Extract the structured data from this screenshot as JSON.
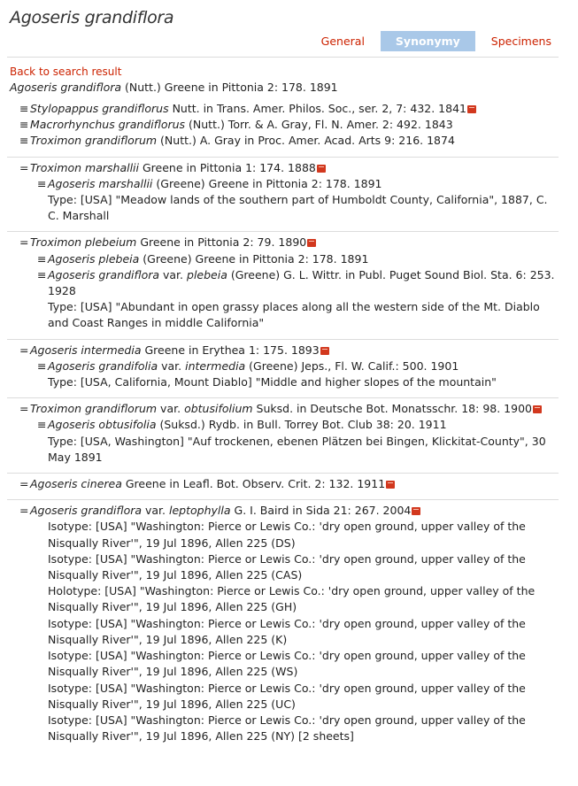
{
  "title": "Agoseris grandiflora",
  "tabs": [
    {
      "label": "General",
      "active": false
    },
    {
      "label": "Synonymy",
      "active": true
    },
    {
      "label": "Specimens",
      "active": false
    }
  ],
  "back_link": "Back to search result",
  "accepted": {
    "name": "Agoseris grandiflora",
    "rest": " (Nutt.) Greene in Pittonia 2: 178. 1891"
  },
  "groups": [
    {
      "lines": [
        {
          "level": 0,
          "sym": "≡",
          "name": "Stylopappus grandiflorus",
          "rest": " Nutt. in Trans. Amer. Philos. Soc., ser. 2, 7: 432. 1841",
          "book": true
        },
        {
          "level": 0,
          "sym": "≡",
          "name": "Macrorhynchus grandiflorus",
          "rest": " (Nutt.) Torr. & A. Gray, Fl. N. Amer. 2: 492. 1843"
        },
        {
          "level": 0,
          "sym": "≡",
          "name": "Troximon grandiflorum",
          "rest": " (Nutt.) A. Gray in Proc. Amer. Acad. Arts 9: 216. 1874"
        }
      ]
    },
    {
      "lines": [
        {
          "level": 0,
          "sym": "=",
          "name": "Troximon marshallii",
          "rest": " Greene in Pittonia 1: 174. 1888",
          "book": true
        },
        {
          "level": 1,
          "sym": "≡",
          "name": "Agoseris marshallii",
          "rest": " (Greene) Greene in Pittonia 2: 178. 1891"
        },
        {
          "level": "t",
          "text": "Type: [USA] \"Meadow lands of the southern part of Humboldt County, California\", 1887, C. C. Marshall"
        }
      ]
    },
    {
      "lines": [
        {
          "level": 0,
          "sym": "=",
          "name": "Troximon plebeium",
          "rest": " Greene in Pittonia 2: 79. 1890",
          "book": true
        },
        {
          "level": 1,
          "sym": "≡",
          "name": "Agoseris plebeia",
          "rest": " (Greene) Greene in Pittonia 2: 178. 1891"
        },
        {
          "level": 1,
          "sym": "≡",
          "name": "Agoseris grandiflora",
          "mid": " var. ",
          "name2": "plebeia",
          "rest": " (Greene) G. L. Wittr. in Publ. Puget Sound Biol. Sta. 6: 253. 1928"
        },
        {
          "level": "t",
          "text": "Type: [USA] \"Abundant in open grassy places along all the western side of the Mt. Diablo and Coast Ranges in middle California\""
        }
      ]
    },
    {
      "lines": [
        {
          "level": 0,
          "sym": "=",
          "name": "Agoseris intermedia",
          "rest": " Greene in Erythea 1: 175. 1893",
          "book": true
        },
        {
          "level": 1,
          "sym": "≡",
          "name": "Agoseris grandifolia",
          "mid": " var. ",
          "name2": "intermedia",
          "rest": " (Greene) Jeps., Fl. W. Calif.: 500. 1901"
        },
        {
          "level": "t",
          "text": "Type: [USA, California, Mount Diablo] \"Middle and higher slopes of the mountain\""
        }
      ]
    },
    {
      "lines": [
        {
          "level": 0,
          "sym": "=",
          "name": "Troximon grandiflorum",
          "mid": " var. ",
          "name2": "obtusifolium",
          "rest": " Suksd. in Deutsche Bot. Monatsschr. 18: 98. 1900",
          "book": true
        },
        {
          "level": 1,
          "sym": "≡",
          "name": "Agoseris obtusifolia",
          "rest": " (Suksd.) Rydb. in Bull. Torrey Bot. Club 38: 20. 1911"
        },
        {
          "level": "t",
          "text": "Type: [USA, Washington] \"Auf trockenen, ebenen Plätzen bei Bingen, Klickitat-County\", 30 May 1891"
        }
      ]
    },
    {
      "lines": [
        {
          "level": 0,
          "sym": "=",
          "name": "Agoseris cinerea",
          "rest": " Greene in Leafl. Bot. Observ. Crit. 2: 132. 1911",
          "book": true
        }
      ]
    },
    {
      "lines": [
        {
          "level": 0,
          "sym": "=",
          "name": "Agoseris grandiflora",
          "mid": " var. ",
          "name2": "leptophylla",
          "rest": " G. I. Baird in Sida 21: 267. 2004",
          "book": true
        },
        {
          "level": "t",
          "text": "Isotype: [USA] \"Washington: Pierce or Lewis Co.: 'dry open ground, upper valley of the Nisqually River'\", 19 Jul 1896, Allen 225 (DS)"
        },
        {
          "level": "t",
          "text": "Isotype: [USA] \"Washington: Pierce or Lewis Co.: 'dry open ground, upper valley of the Nisqually River'\", 19 Jul 1896, Allen 225 (CAS)"
        },
        {
          "level": "t",
          "text": "Holotype: [USA] \"Washington: Pierce or Lewis Co.: 'dry open ground, upper valley of the Nisqually River'\", 19 Jul 1896, Allen 225 (GH)"
        },
        {
          "level": "t",
          "text": "Isotype: [USA] \"Washington: Pierce or Lewis Co.: 'dry open ground, upper valley of the Nisqually River'\", 19 Jul 1896, Allen 225 (K)"
        },
        {
          "level": "t",
          "text": "Isotype: [USA] \"Washington: Pierce or Lewis Co.: 'dry open ground, upper valley of the Nisqually River'\", 19 Jul 1896, Allen 225 (WS)"
        },
        {
          "level": "t",
          "text": "Isotype: [USA] \"Washington: Pierce or Lewis Co.: 'dry open ground, upper valley of the Nisqually River'\", 19 Jul 1896, Allen 225 (UC)"
        },
        {
          "level": "t",
          "text": "Isotype: [USA] \"Washington: Pierce or Lewis Co.: 'dry open ground, upper valley of the Nisqually River'\", 19 Jul 1896, Allen 225 (NY) [2 sheets]"
        }
      ]
    }
  ]
}
